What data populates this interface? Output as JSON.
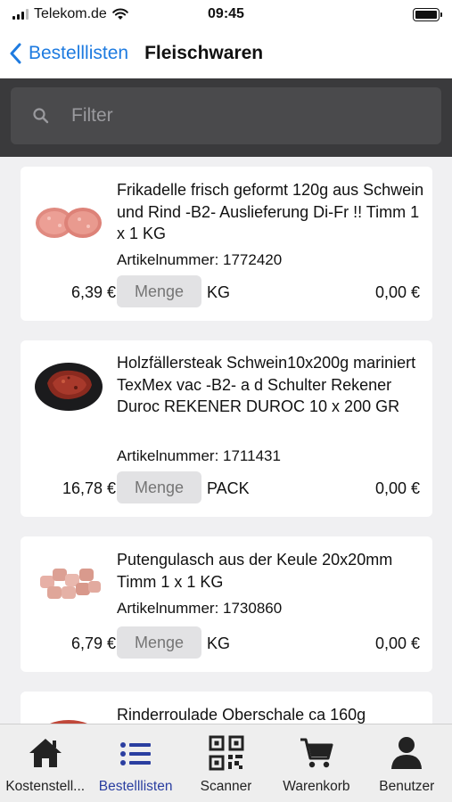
{
  "status_bar": {
    "carrier": "Telekom.de",
    "time": "09:45"
  },
  "nav": {
    "back_label": "Bestelllisten",
    "title": "Fleischwaren"
  },
  "search": {
    "placeholder": "Filter",
    "value": ""
  },
  "products": [
    {
      "title": "Frikadelle frisch geformt 120g aus Schwein und Rind -B2- Auslieferung Di-Fr !! Timm 1 x 1 KG",
      "article": "Artikelnummer: 1772420",
      "price": "6,39 €",
      "qty_placeholder": "Menge",
      "unit": "KG",
      "total": "0,00 €",
      "image": "meat-patties-image"
    },
    {
      "title": "Holzfällersteak Schwein10x200g mariniert TexMex vac -B2- a d Schulter Rekener Duroc REKENER DUROC 10 x 200 GR",
      "article": "Artikelnummer: 1711431",
      "price": "16,78 €",
      "qty_placeholder": "Menge",
      "unit": "PACK",
      "total": "0,00 €",
      "image": "marinated-steak-image"
    },
    {
      "title": "Putengulasch aus der Keule 20x20mm  Timm 1 x 1 KG",
      "article": "Artikelnummer: 1730860",
      "price": "6,79 €",
      "qty_placeholder": "Menge",
      "unit": "KG",
      "total": "0,00 €",
      "image": "turkey-goulash-image"
    },
    {
      "title": "Rinderroulade Oberschale ca 160g",
      "image": "beef-roulade-image"
    }
  ],
  "tabs": [
    {
      "label": "Kostenstell...",
      "icon": "home-icon",
      "active": false
    },
    {
      "label": "Bestelllisten",
      "icon": "list-icon",
      "active": true
    },
    {
      "label": "Scanner",
      "icon": "qr-code-icon",
      "active": false
    },
    {
      "label": "Warenkorb",
      "icon": "cart-icon",
      "active": false
    },
    {
      "label": "Benutzer",
      "icon": "user-icon",
      "active": false
    }
  ],
  "colors": {
    "accent": "#1e7be0",
    "active_tab": "#2a3ea0",
    "search_bg": "#3a3a3c"
  }
}
